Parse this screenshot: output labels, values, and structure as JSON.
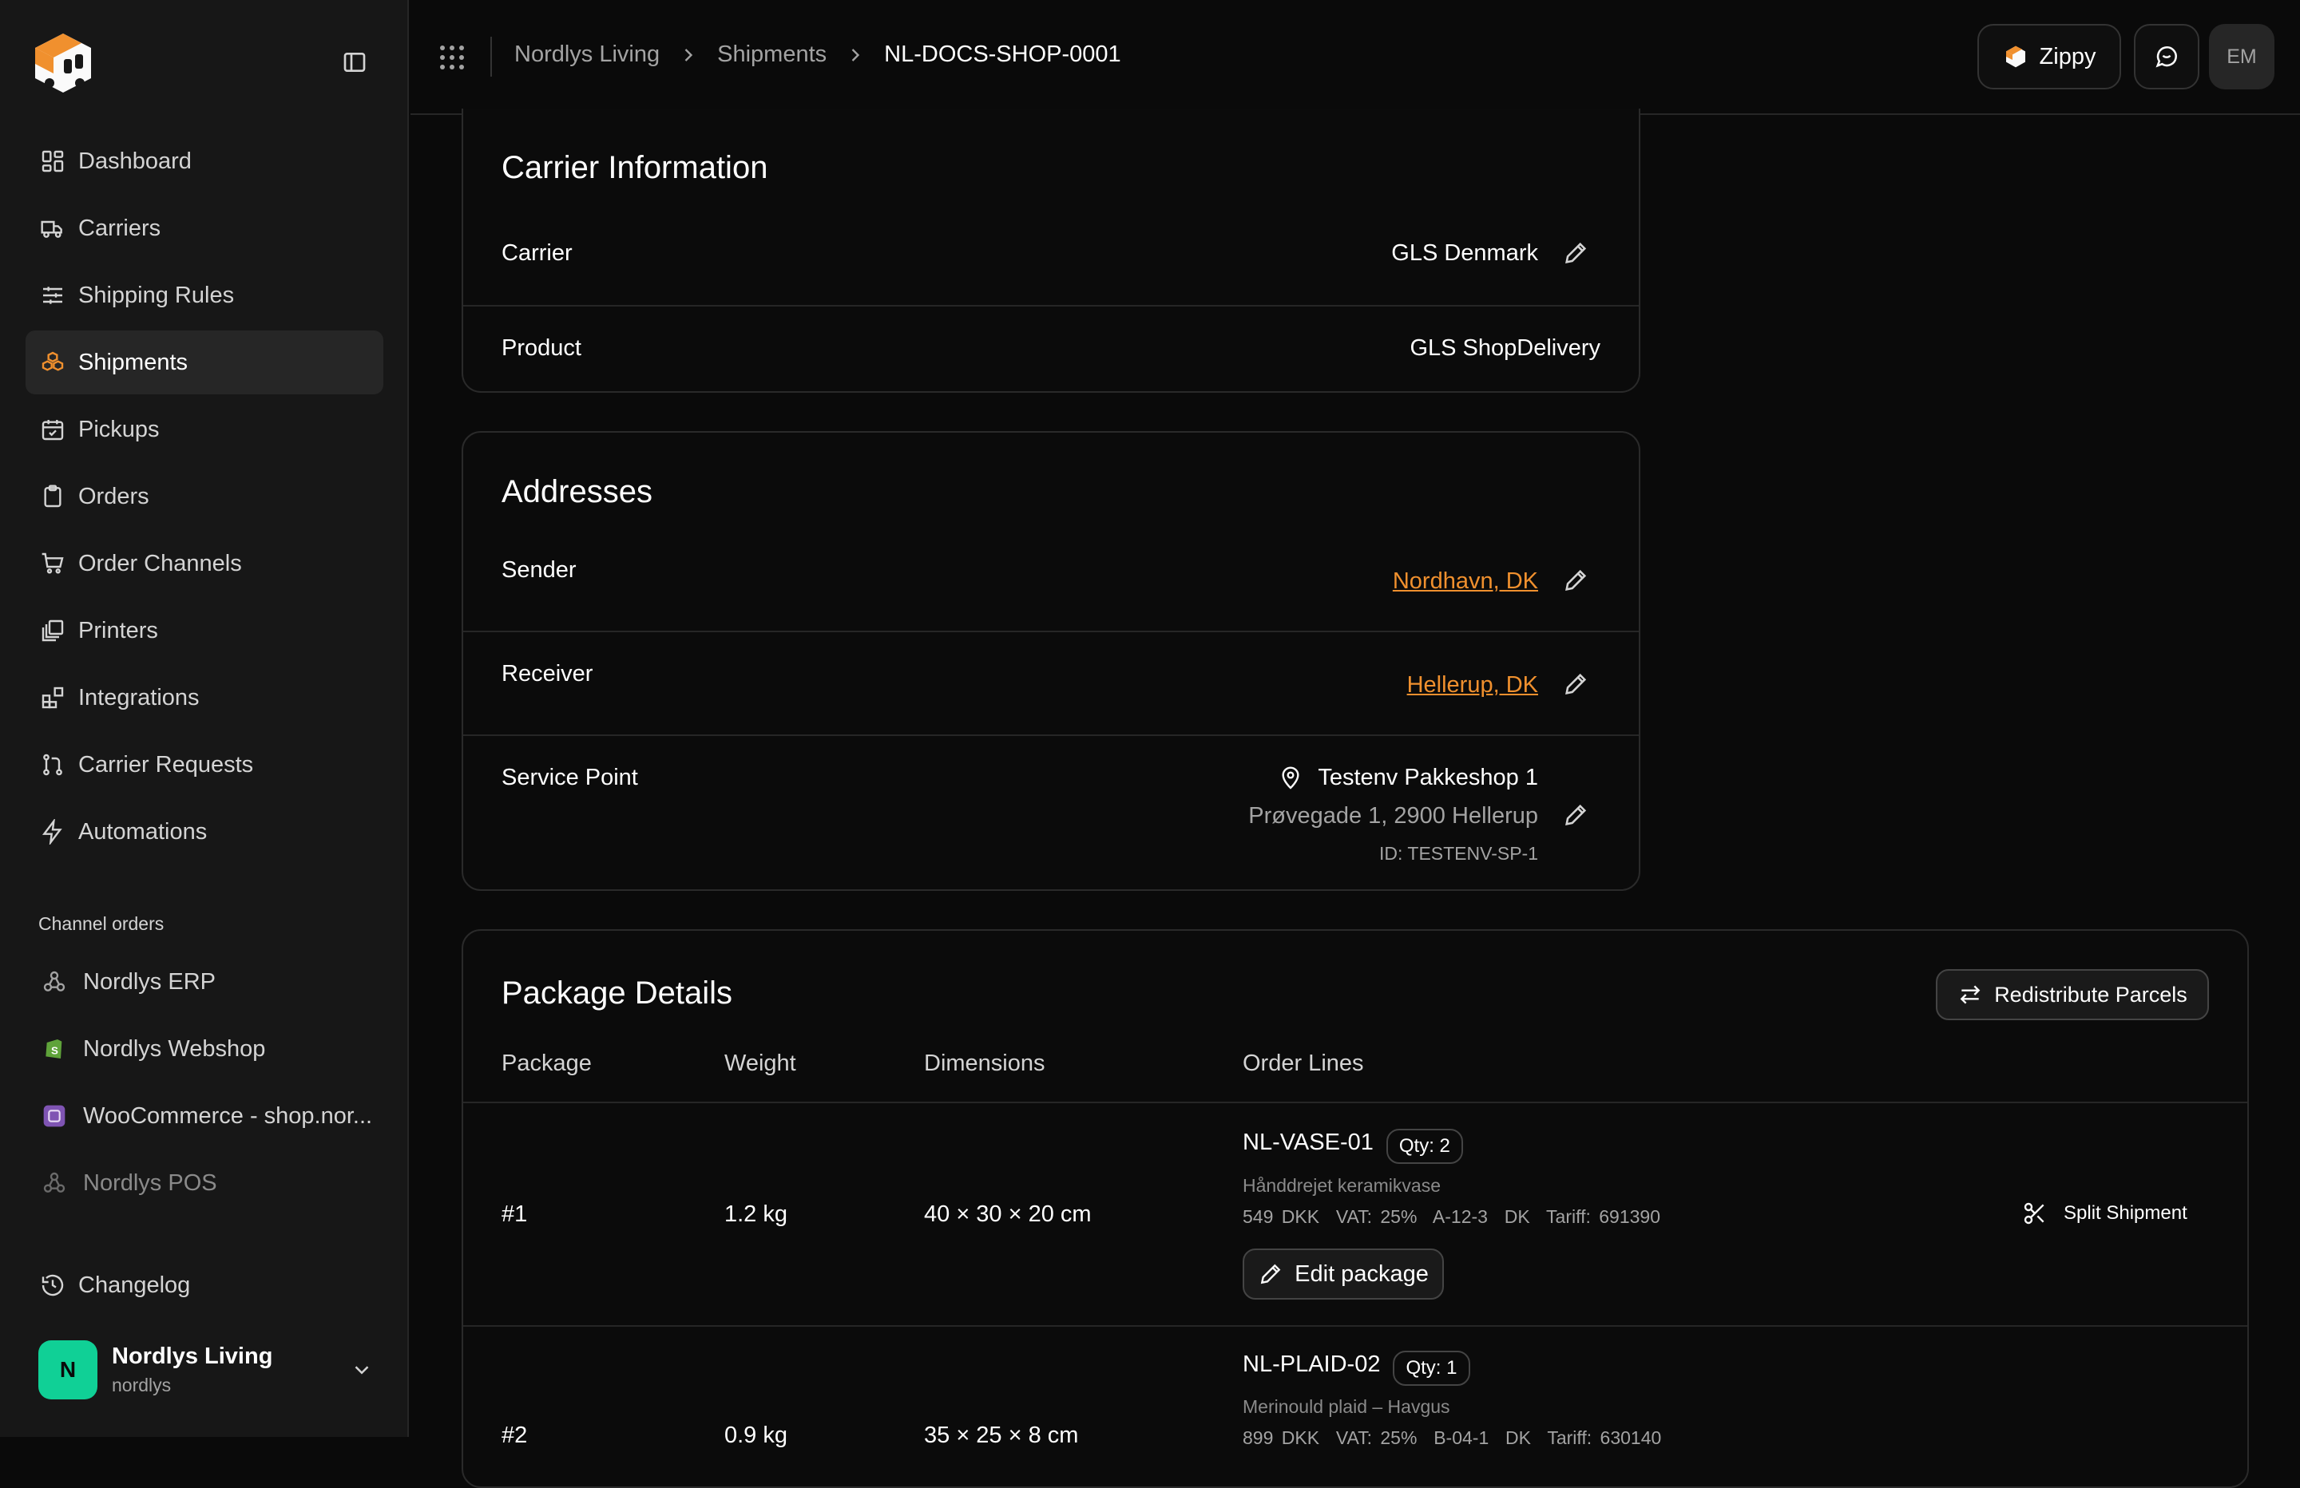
{
  "sidebar": {
    "nav": [
      {
        "label": "Dashboard",
        "icon": "dashboard-icon"
      },
      {
        "label": "Carriers",
        "icon": "truck-icon"
      },
      {
        "label": "Shipping Rules",
        "icon": "sliders-icon"
      },
      {
        "label": "Shipments",
        "icon": "boxes-icon",
        "active": true
      },
      {
        "label": "Pickups",
        "icon": "calendar-check-icon"
      },
      {
        "label": "Orders",
        "icon": "clipboard-icon"
      },
      {
        "label": "Order Channels",
        "icon": "cart-icon"
      },
      {
        "label": "Printers",
        "icon": "printer-icon"
      },
      {
        "label": "Integrations",
        "icon": "blocks-icon"
      },
      {
        "label": "Carrier Requests",
        "icon": "git-pull-icon"
      },
      {
        "label": "Automations",
        "icon": "zap-icon"
      }
    ],
    "channels_label": "Channel orders",
    "channels": [
      {
        "label": "Nordlys ERP",
        "icon": "webhook-icon"
      },
      {
        "label": "Nordlys Webshop",
        "icon": "shopify-icon"
      },
      {
        "label": "WooCommerce - shop.nor...",
        "icon": "woocommerce-icon"
      },
      {
        "label": "Nordlys POS",
        "icon": "webhook-icon"
      }
    ],
    "changelog": "Changelog",
    "user": {
      "initial": "N",
      "name": "Nordlys Living",
      "handle": "nordlys"
    }
  },
  "header": {
    "breadcrumb": [
      "Nordlys Living",
      "Shipments",
      "NL-DOCS-SHOP-0001"
    ],
    "assistant_label": "Zippy",
    "user_initials": "EM"
  },
  "carrier_info": {
    "title": "Carrier Information",
    "carrier_label": "Carrier",
    "carrier_value": "GLS Denmark",
    "product_label": "Product",
    "product_value": "GLS ShopDelivery"
  },
  "addresses": {
    "title": "Addresses",
    "sender_label": "Sender",
    "sender_value": "Nordhavn, DK",
    "receiver_label": "Receiver",
    "receiver_value": "Hellerup, DK",
    "service_point_label": "Service Point",
    "service_point_name": "Testenv Pakkeshop 1",
    "service_point_address": "Prøvegade 1, 2900 Hellerup",
    "service_point_id": "ID: TESTENV-SP-1"
  },
  "packages": {
    "title": "Package Details",
    "redistribute_label": "Redistribute Parcels",
    "columns": [
      "Package",
      "Weight",
      "Dimensions",
      "Order Lines"
    ],
    "rows": [
      {
        "id": "#1",
        "weight": "1.2 kg",
        "dimensions": "40 × 30 × 20 cm",
        "sku": "NL-VASE-01",
        "qty": "Qty: 2",
        "description": "Hånddrejet keramikvase",
        "meta": "549 DKK  VAT: 25%  A-12-3  DK  Tariff: 691390",
        "edit_label": "Edit package",
        "split_label": "Split Shipment"
      },
      {
        "id": "#2",
        "weight": "0.9 kg",
        "dimensions": "35 × 25 × 8 cm",
        "sku": "NL-PLAID-02",
        "qty": "Qty: 1",
        "description": "Merinould plaid – Havgus",
        "meta": "899 DKK  VAT: 25%  B-04-1  DK  Tariff: 630140"
      }
    ]
  },
  "colors": {
    "accent": "#f0902e",
    "avatar": "#10d096",
    "background": "#0a0a0a",
    "sidebar": "#171717"
  }
}
